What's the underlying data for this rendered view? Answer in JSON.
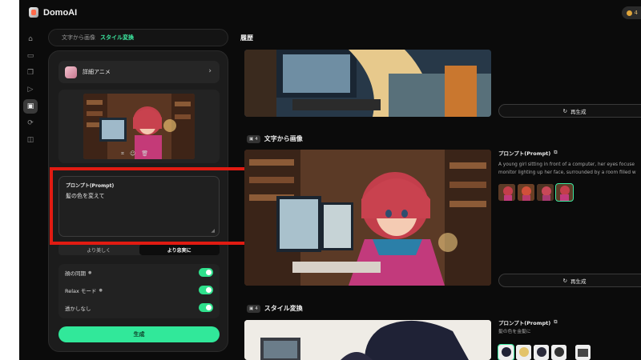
{
  "app": {
    "name": "DomoAI",
    "credits": "4"
  },
  "rail": [
    {
      "icon": "home-icon",
      "glyph": "⌂"
    },
    {
      "icon": "image-stack-icon",
      "glyph": "▭"
    },
    {
      "icon": "copy-icon",
      "glyph": "❐"
    },
    {
      "icon": "video-icon",
      "glyph": "▷"
    },
    {
      "icon": "image-icon",
      "glyph": "▣"
    },
    {
      "icon": "sync-icon",
      "glyph": "⟳"
    },
    {
      "icon": "layers-icon",
      "glyph": "◫"
    }
  ],
  "tabs": {
    "text_to_image": "文字から画像",
    "style_transfer": "スタイル変換"
  },
  "panel": {
    "style_name": "詳細アニメ",
    "prompt_label": "プロンプト(Prompt)",
    "prompt_value": "髪の色を変えて",
    "fidelity": {
      "left": "より美しく",
      "right": "より忠実に"
    },
    "toggles": [
      {
        "label": "顔の同期",
        "info": "●"
      },
      {
        "label": "Relax モード",
        "info": "●"
      },
      {
        "label": "透かしなし",
        "info": ""
      }
    ],
    "generate": "生成"
  },
  "history": {
    "title": "履歴",
    "regen": "再生成",
    "sections": [
      {
        "count": "4",
        "title": "文字から画像",
        "prompt_title": "プロンプト(Prompt)",
        "prompt_lines": [
          "A young girl sitting in front of a computer, her eyes focuse",
          "monitor lighting up her face, surrounded by a room filled w"
        ]
      },
      {
        "count": "4",
        "title": "スタイル変換",
        "prompt_title": "プロンプト(Prompt)",
        "prompt_lines": [
          "髪の色を金髪に"
        ]
      }
    ]
  },
  "colors": {
    "accent": "#31e89a",
    "highlight": "#e11b12",
    "background": "#0b0b0b"
  }
}
